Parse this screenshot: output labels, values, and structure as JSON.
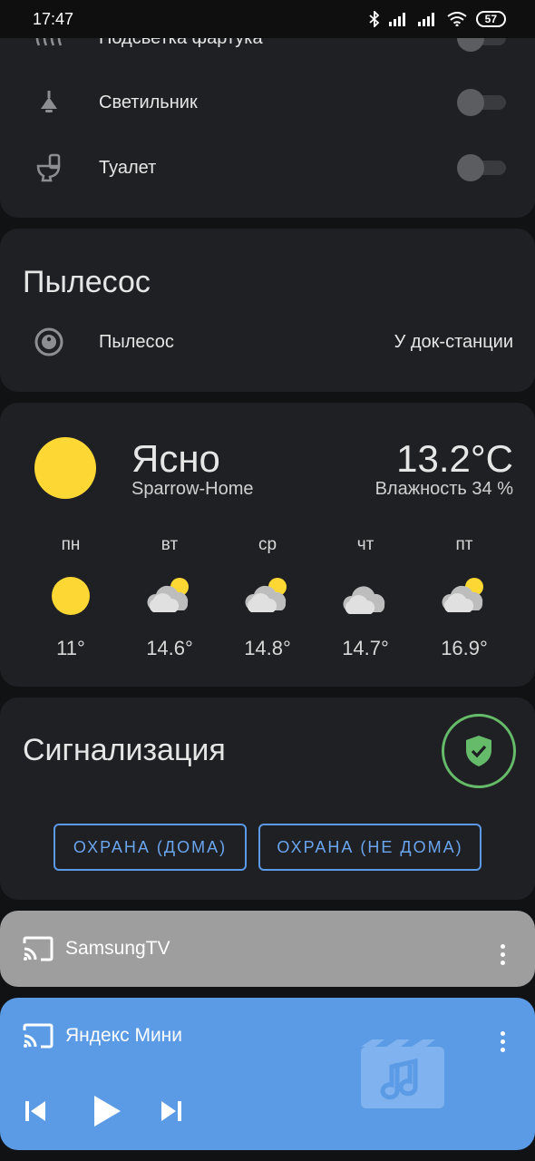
{
  "status_bar": {
    "time": "17:47",
    "battery": "57"
  },
  "lights": {
    "items": [
      {
        "label": "Подсветка фартука",
        "icon": "led-strip-icon",
        "on": false
      },
      {
        "label": "Светильник",
        "icon": "ceiling-lamp-icon",
        "on": false
      },
      {
        "label": "Туалет",
        "icon": "toilet-icon",
        "on": false
      }
    ]
  },
  "vacuum": {
    "title": "Пылесос",
    "entity_label": "Пылесос",
    "state": "У док-станции",
    "icon": "robot-vacuum-icon"
  },
  "weather": {
    "condition": "Ясно",
    "location": "Sparrow-Home",
    "temperature": "13.2°C",
    "humidity": "Влажность 34 %",
    "forecast": [
      {
        "day": "пн",
        "temp": "11°",
        "icon": "sun-icon"
      },
      {
        "day": "вт",
        "temp": "14.6°",
        "icon": "partly-cloudy-icon"
      },
      {
        "day": "ср",
        "temp": "14.8°",
        "icon": "partly-cloudy-icon"
      },
      {
        "day": "чт",
        "temp": "14.7°",
        "icon": "cloudy-icon"
      },
      {
        "day": "пт",
        "temp": "16.9°",
        "icon": "partly-cloudy-icon"
      }
    ],
    "sun_color": "#fdd835"
  },
  "alarm": {
    "title": "Сигнализация",
    "arm_home": "ОХРАНА (ДОМА)",
    "arm_away": "ОХРАНА (НЕ ДОМА)",
    "status_icon": "shield-check-icon",
    "accent": "#66bb6a"
  },
  "media": [
    {
      "name": "SamsungTV",
      "bg": "#9e9e9e"
    },
    {
      "name": "Яндекс Мини",
      "bg": "#5b9be6"
    }
  ],
  "colors": {
    "card": "#1f2023",
    "background": "#111214",
    "button_accent": "#5a9ae8"
  }
}
